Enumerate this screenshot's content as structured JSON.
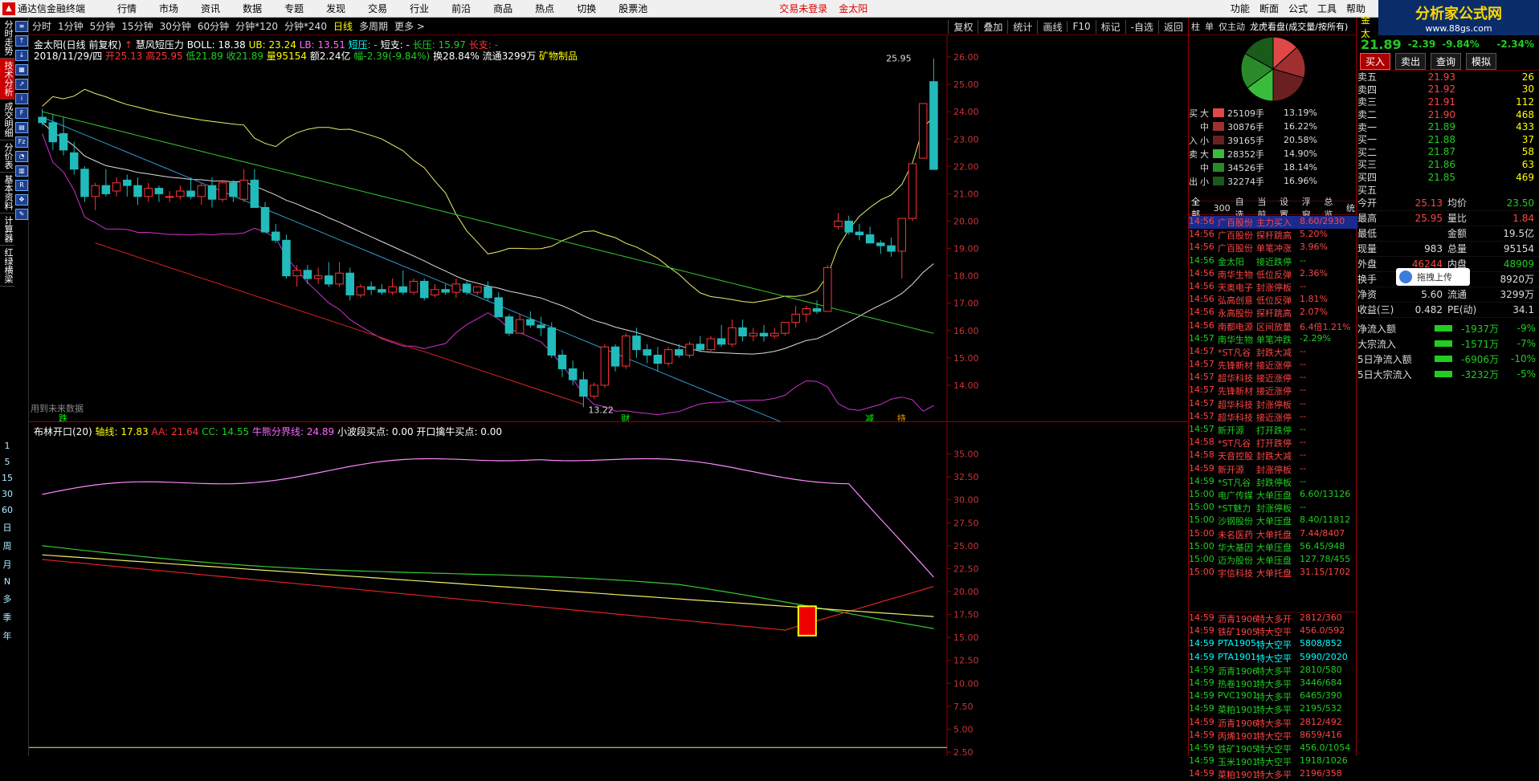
{
  "menubar": {
    "app": "通达信金融终端",
    "items": [
      "行情",
      "市场",
      "资讯",
      "数据",
      "专题",
      "发现",
      "交易",
      "行业",
      "前沿",
      "商品",
      "热点",
      "切换",
      "股票池"
    ],
    "alert": "交易未登录",
    "stock": "金太阳",
    "right": [
      "功能",
      "断面",
      "公式",
      "工具",
      "帮助"
    ]
  },
  "brand": {
    "name": "分析家公式网",
    "url": "www.88gs.com"
  },
  "lefttabs": [
    "分时走势",
    "技术分析",
    "成交明细",
    "分价表",
    "基本资料",
    "计算器",
    "红绿横梁"
  ],
  "leftperiods": [
    "1",
    "5",
    "15",
    "30",
    "60",
    "日",
    "周",
    "月",
    "N",
    "多",
    "季",
    "年"
  ],
  "toolbar": {
    "periods": [
      "分时",
      "1分钟",
      "5分钟",
      "15分钟",
      "30分钟",
      "60分钟",
      "分钟*120",
      "分钟*240",
      "日线",
      "多周期",
      "更多 >"
    ],
    "active": "日线",
    "right": [
      "复权",
      "叠加",
      "统计",
      "画线",
      "F10",
      "标记",
      "-自选",
      "返回"
    ]
  },
  "chart_info": {
    "line1": [
      "金太阳(日线 前复权)",
      "慧风短压力",
      "BOLL: 18.38",
      "UB: 23.24",
      "LB: 13.51",
      "短压: -",
      "短支: -",
      "长压: 15.97",
      "长支: -"
    ],
    "date": "2018/11/29/四",
    "open": "开25.13",
    "high": "高25.95",
    "low": "低21.89",
    "close": "收21.89",
    "vol": "量95154",
    "amt": "额2.24亿",
    "chg": "幅-2.39(-9.84%)",
    "turn": "换28.84%",
    "float": "流通3299万",
    "industry": "矿物制品"
  },
  "chart_annotations": {
    "max": "25.95",
    "min": "13.22",
    "future": "用到未来数据",
    "marks": [
      "跌",
      "财",
      "减",
      "持"
    ]
  },
  "chart_data": [
    {
      "type": "candlestick",
      "title": "金太阳(日线 前复权)",
      "ylim": [
        13,
        26.5
      ],
      "yticks": [
        14,
        15,
        16,
        17,
        18,
        19,
        20,
        21,
        22,
        23,
        24,
        25,
        26
      ],
      "candles": [
        [
          23.8,
          24.1,
          23.5,
          23.6
        ],
        [
          23.6,
          23.9,
          22.6,
          22.9
        ],
        [
          23.2,
          23.8,
          22.4,
          22.6
        ],
        [
          22.5,
          22.9,
          21.7,
          21.9
        ],
        [
          21.9,
          22.0,
          20.7,
          20.9
        ],
        [
          20.9,
          21.4,
          20.4,
          21.3
        ],
        [
          21.3,
          21.9,
          20.9,
          21.0
        ],
        [
          21.1,
          21.6,
          20.9,
          21.4
        ],
        [
          21.5,
          21.7,
          20.9,
          21.3
        ],
        [
          21.3,
          21.6,
          20.6,
          20.9
        ],
        [
          20.9,
          21.4,
          20.7,
          21.2
        ],
        [
          21.2,
          21.3,
          20.7,
          21.0
        ],
        [
          20.9,
          21.1,
          20.7,
          20.9
        ],
        [
          20.9,
          21.3,
          20.8,
          21.1
        ],
        [
          21.1,
          21.6,
          20.8,
          20.9
        ],
        [
          20.9,
          21.4,
          20.6,
          21.3
        ],
        [
          21.3,
          21.6,
          20.5,
          20.8
        ],
        [
          20.8,
          21.5,
          20.7,
          21.4
        ],
        [
          21.4,
          21.5,
          20.7,
          20.9
        ],
        [
          20.8,
          21.9,
          20.7,
          21.5
        ],
        [
          21.5,
          21.9,
          20.7,
          20.5
        ],
        [
          20.5,
          20.7,
          19.7,
          19.6
        ],
        [
          19.6,
          19.9,
          19.2,
          19.3
        ],
        [
          19.3,
          19.5,
          17.9,
          18.0
        ],
        [
          18.0,
          18.4,
          17.6,
          18.2
        ],
        [
          18.2,
          18.4,
          17.7,
          17.9
        ],
        [
          17.9,
          18.3,
          17.7,
          18.0
        ],
        [
          18.0,
          18.5,
          17.6,
          17.7
        ],
        [
          17.7,
          18.5,
          17.6,
          18.1
        ],
        [
          18.1,
          18.3,
          17.1,
          17.3
        ],
        [
          17.3,
          17.7,
          17.2,
          17.6
        ],
        [
          17.6,
          17.8,
          17.3,
          17.5
        ],
        [
          17.5,
          17.7,
          17.3,
          17.4
        ],
        [
          17.4,
          17.9,
          17.3,
          17.6
        ],
        [
          17.6,
          18.2,
          17.3,
          17.4
        ],
        [
          17.4,
          17.9,
          17.3,
          17.8
        ],
        [
          17.8,
          17.9,
          17.1,
          17.2
        ],
        [
          17.3,
          17.7,
          17.2,
          17.5
        ],
        [
          17.5,
          17.7,
          17.3,
          17.4
        ],
        [
          17.4,
          17.9,
          17.2,
          17.7
        ],
        [
          17.7,
          17.8,
          17.3,
          17.4
        ],
        [
          17.4,
          17.6,
          17.3,
          17.6
        ],
        [
          17.6,
          17.8,
          17.1,
          17.2
        ],
        [
          17.2,
          17.4,
          16.5,
          16.5
        ],
        [
          16.5,
          16.6,
          15.8,
          15.9
        ],
        [
          15.9,
          16.6,
          15.9,
          16.4
        ],
        [
          16.4,
          16.7,
          16.1,
          16.2
        ],
        [
          16.2,
          16.5,
          15.8,
          16.1
        ],
        [
          16.1,
          16.3,
          15.0,
          15.1
        ],
        [
          15.1,
          15.3,
          14.3,
          14.6
        ],
        [
          14.6,
          14.9,
          14.0,
          14.2
        ],
        [
          14.2,
          14.5,
          13.2,
          13.6
        ],
        [
          13.6,
          14.1,
          13.5,
          14.0
        ],
        [
          14.0,
          15.5,
          13.9,
          15.4
        ],
        [
          15.4,
          15.5,
          14.5,
          14.7
        ],
        [
          14.7,
          15.9,
          14.6,
          15.8
        ],
        [
          15.8,
          16.1,
          15.0,
          15.3
        ],
        [
          15.3,
          15.5,
          14.8,
          15.1
        ],
        [
          15.1,
          15.4,
          14.5,
          14.8
        ],
        [
          14.8,
          15.4,
          14.7,
          15.3
        ],
        [
          15.3,
          15.5,
          15.0,
          15.1
        ],
        [
          15.1,
          15.6,
          15.0,
          15.5
        ],
        [
          15.5,
          15.8,
          15.2,
          15.3
        ],
        [
          15.3,
          15.8,
          15.2,
          15.7
        ],
        [
          15.7,
          16.2,
          15.4,
          15.5
        ],
        [
          15.5,
          16.4,
          15.4,
          16.1
        ],
        [
          16.1,
          16.4,
          15.6,
          15.8
        ],
        [
          15.8,
          16.1,
          15.6,
          15.9
        ],
        [
          15.9,
          16.2,
          15.6,
          15.8
        ],
        [
          15.8,
          16.1,
          15.7,
          15.9
        ],
        [
          15.9,
          16.3,
          15.8,
          16.3
        ],
        [
          16.3,
          16.9,
          16.1,
          16.6
        ],
        [
          16.6,
          16.9,
          16.3,
          16.8
        ],
        [
          16.8,
          17.1,
          16.6,
          16.7
        ],
        [
          16.7,
          18.4,
          16.7,
          18.3
        ],
        [
          19.8,
          20.3,
          19.7,
          20.0
        ],
        [
          20.0,
          20.2,
          19.5,
          19.6
        ],
        [
          19.6,
          19.9,
          19.3,
          19.5
        ],
        [
          19.5,
          19.8,
          19.2,
          19.2
        ],
        [
          19.2,
          19.3,
          18.8,
          19.1
        ],
        [
          19.1,
          19.4,
          18.7,
          18.9
        ],
        [
          18.9,
          20.1,
          17.9,
          20.1
        ],
        [
          20.1,
          22.1,
          20.0,
          22.1
        ],
        [
          22.3,
          24.3,
          22.3,
          24.3
        ],
        [
          25.1,
          25.95,
          21.89,
          21.89
        ]
      ]
    },
    {
      "type": "line",
      "title": "布林开口(20)",
      "ylim": [
        2.5,
        37.5
      ],
      "yticks": [
        2.5,
        5,
        7.5,
        10,
        12.5,
        15,
        17.5,
        20,
        22.5,
        25,
        27.5,
        30,
        32.5,
        35
      ],
      "series": [
        {
          "name": "轴线",
          "value": "17.83"
        },
        {
          "name": "AA",
          "value": "21.64"
        },
        {
          "name": "CC",
          "value": "14.55"
        },
        {
          "name": "牛熊分界线",
          "value": "24.89"
        },
        {
          "name": "小波段买点",
          "value": "0.00"
        },
        {
          "name": "开口擒牛买点",
          "value": "0.00"
        }
      ]
    }
  ],
  "mid": {
    "tabs": [
      "柱",
      "单",
      "仅主动",
      "龙虎看盘(成交量/按所有)"
    ],
    "flow": [
      {
        "s": "买",
        "l": "大",
        "v": "25109手",
        "p": "13.19%",
        "c": "#e04848"
      },
      {
        "s": "",
        "l": "中",
        "v": "30876手",
        "p": "16.22%",
        "c": "#a03030"
      },
      {
        "s": "入",
        "l": "小",
        "v": "39165手",
        "p": "20.58%",
        "c": "#6a2020"
      },
      {
        "s": "卖",
        "l": "大",
        "v": "28352手",
        "p": "14.90%",
        "c": "#3bbb3b"
      },
      {
        "s": "",
        "l": "中",
        "v": "34526手",
        "p": "18.14%",
        "c": "#2a8a2a"
      },
      {
        "s": "出",
        "l": "小",
        "v": "32274手",
        "p": "16.96%",
        "c": "#1a5a1a"
      }
    ],
    "tabs2": [
      "全部",
      "300",
      "自选",
      "当前",
      "设置",
      "浮窗",
      "总览",
      "统"
    ],
    "ticks": [
      [
        "14:56",
        "广百股份",
        "主力买入",
        "8.60/2930",
        "r",
        true
      ],
      [
        "14:56",
        "广百股份",
        "探杆跳高",
        "5.20%",
        "r"
      ],
      [
        "14:56",
        "广百股份",
        "单笔冲涨",
        "3.96%",
        "r"
      ],
      [
        "14:56",
        "金太阳",
        "接近跌停",
        "--",
        "g"
      ],
      [
        "14:56",
        "南华生物",
        "低位反弹",
        "2.36%",
        "r"
      ],
      [
        "14:56",
        "天奥电子",
        "封涨停板",
        "--",
        "r"
      ],
      [
        "14:56",
        "弘高创意",
        "低位反弹",
        "1.81%",
        "r"
      ],
      [
        "14:56",
        "永高股份",
        "探杆跳高",
        "2.07%",
        "r"
      ],
      [
        "14:56",
        "南都电源",
        "区间放量",
        "6.4倍1.21%",
        "r"
      ],
      [
        "14:57",
        "南华生物",
        "单笔冲跌",
        "-2.29%",
        "g"
      ],
      [
        "14:57",
        "*ST凡谷",
        "封跌大减",
        "--",
        "r"
      ],
      [
        "14:57",
        "先锋新材",
        "接近涨停",
        "--",
        "r"
      ],
      [
        "14:57",
        "超华科技",
        "接近涨停",
        "--",
        "r"
      ],
      [
        "14:57",
        "先锋新材",
        "接近涨停",
        "--",
        "r"
      ],
      [
        "14:57",
        "超华科技",
        "封涨停板",
        "--",
        "r"
      ],
      [
        "14:57",
        "超华科技",
        "接近涨停",
        "--",
        "r"
      ],
      [
        "14:57",
        "新开源",
        "打开跌停",
        "--",
        "g"
      ],
      [
        "14:58",
        "*ST凡谷",
        "打开跌停",
        "--",
        "r"
      ],
      [
        "14:58",
        "天音控股",
        "封跌大减",
        "--",
        "r"
      ],
      [
        "14:59",
        "新开源",
        "封涨停板",
        "--",
        "r"
      ],
      [
        "14:59",
        "*ST凡谷",
        "封跌停板",
        "--",
        "g"
      ],
      [
        "15:00",
        "电广传媒",
        "大单压盘",
        "6.60/13126",
        "g"
      ],
      [
        "15:00",
        "*ST魅力",
        "封涨停板",
        "--",
        "g"
      ],
      [
        "15:00",
        "沙钢股份",
        "大单压盘",
        "8.40/11812",
        "g"
      ],
      [
        "15:00",
        "未名医药",
        "大单托盘",
        "7.44/8407",
        "r"
      ],
      [
        "15:00",
        "华大基因",
        "大单压盘",
        "56.45/948",
        "g"
      ],
      [
        "15:00",
        "迈为股份",
        "大单压盘",
        "127.78/455",
        "g"
      ],
      [
        "15:00",
        "宇信科技",
        "大单托盘",
        "31.15/1702",
        "r"
      ]
    ],
    "futures": [
      [
        "14:59",
        "沥青1906",
        "特大多开",
        "2812/360",
        "r"
      ],
      [
        "14:59",
        "铁矿1905",
        "特大空平",
        "456.0/592",
        "r"
      ],
      [
        "14:59",
        "PTA1905",
        "特大空平",
        "5808/852",
        "c"
      ],
      [
        "14:59",
        "PTA1901",
        "特大空平",
        "5990/2020",
        "c"
      ],
      [
        "14:59",
        "沥青1906",
        "特大多平",
        "2810/580",
        "g"
      ],
      [
        "14:59",
        "热卷1901",
        "特大多平",
        "3446/684",
        "g"
      ],
      [
        "14:59",
        "PVC1901",
        "特大多平",
        "6465/390",
        "g"
      ],
      [
        "14:59",
        "菜粕1901",
        "特大多平",
        "2195/532",
        "g"
      ],
      [
        "14:59",
        "沥青1906",
        "特大多平",
        "2812/492",
        "r"
      ],
      [
        "14:59",
        "丙烯1901",
        "特大空平",
        "8659/416",
        "r"
      ],
      [
        "14:59",
        "铁矿1905",
        "特大空平",
        "456.0/1054",
        "g"
      ],
      [
        "14:59",
        "玉米1901",
        "特大空平",
        "1918/1026",
        "g"
      ],
      [
        "14:59",
        "菜粕1901",
        "特大多平",
        "2196/358",
        "r"
      ]
    ]
  },
  "right": {
    "code": "金太",
    "price": "21.89",
    "chg": "-2.39",
    "pct": "-9.84%",
    "pct2": "-2.34%",
    "buttons": [
      "买入",
      "卖出",
      "查询",
      "模拟"
    ],
    "asks": [
      [
        "卖五",
        "21.93",
        "26"
      ],
      [
        "卖四",
        "21.92",
        "30"
      ],
      [
        "卖三",
        "21.91",
        "112"
      ],
      [
        "卖二",
        "21.90",
        "468"
      ],
      [
        "卖一",
        "21.89",
        "433"
      ]
    ],
    "bids": [
      [
        "买一",
        "21.88",
        "37"
      ],
      [
        "买二",
        "21.87",
        "58"
      ],
      [
        "买三",
        "21.86",
        "63"
      ],
      [
        "买四",
        "21.85",
        "469"
      ],
      [
        "买五",
        "",
        ""
      ]
    ],
    "stats": [
      [
        "今开",
        "25.13",
        "均价",
        "23.50"
      ],
      [
        "最高",
        "25.95",
        "量比",
        "1.84"
      ],
      [
        "最低",
        "",
        "金额",
        "19.5亿"
      ],
      [
        "现量",
        "983",
        "总量",
        "95154"
      ],
      [
        "外盘",
        "46244",
        "内盘",
        "48909"
      ],
      [
        "换手",
        "28.84%",
        "股本",
        "8920万"
      ],
      [
        "净资",
        "5.60",
        "流通",
        "3299万"
      ],
      [
        "收益(三)",
        "0.482",
        "PE(动)",
        "34.1"
      ]
    ],
    "netflow": [
      [
        "净流入额",
        "-1937万",
        "-9%"
      ],
      [
        "大宗流入",
        "-1571万",
        "-7%"
      ],
      [
        "5日净流入额",
        "-6906万",
        "-10%"
      ],
      [
        "5日大宗流入",
        "-3232万",
        "-5%"
      ]
    ],
    "float_button": "拖拽上传"
  }
}
